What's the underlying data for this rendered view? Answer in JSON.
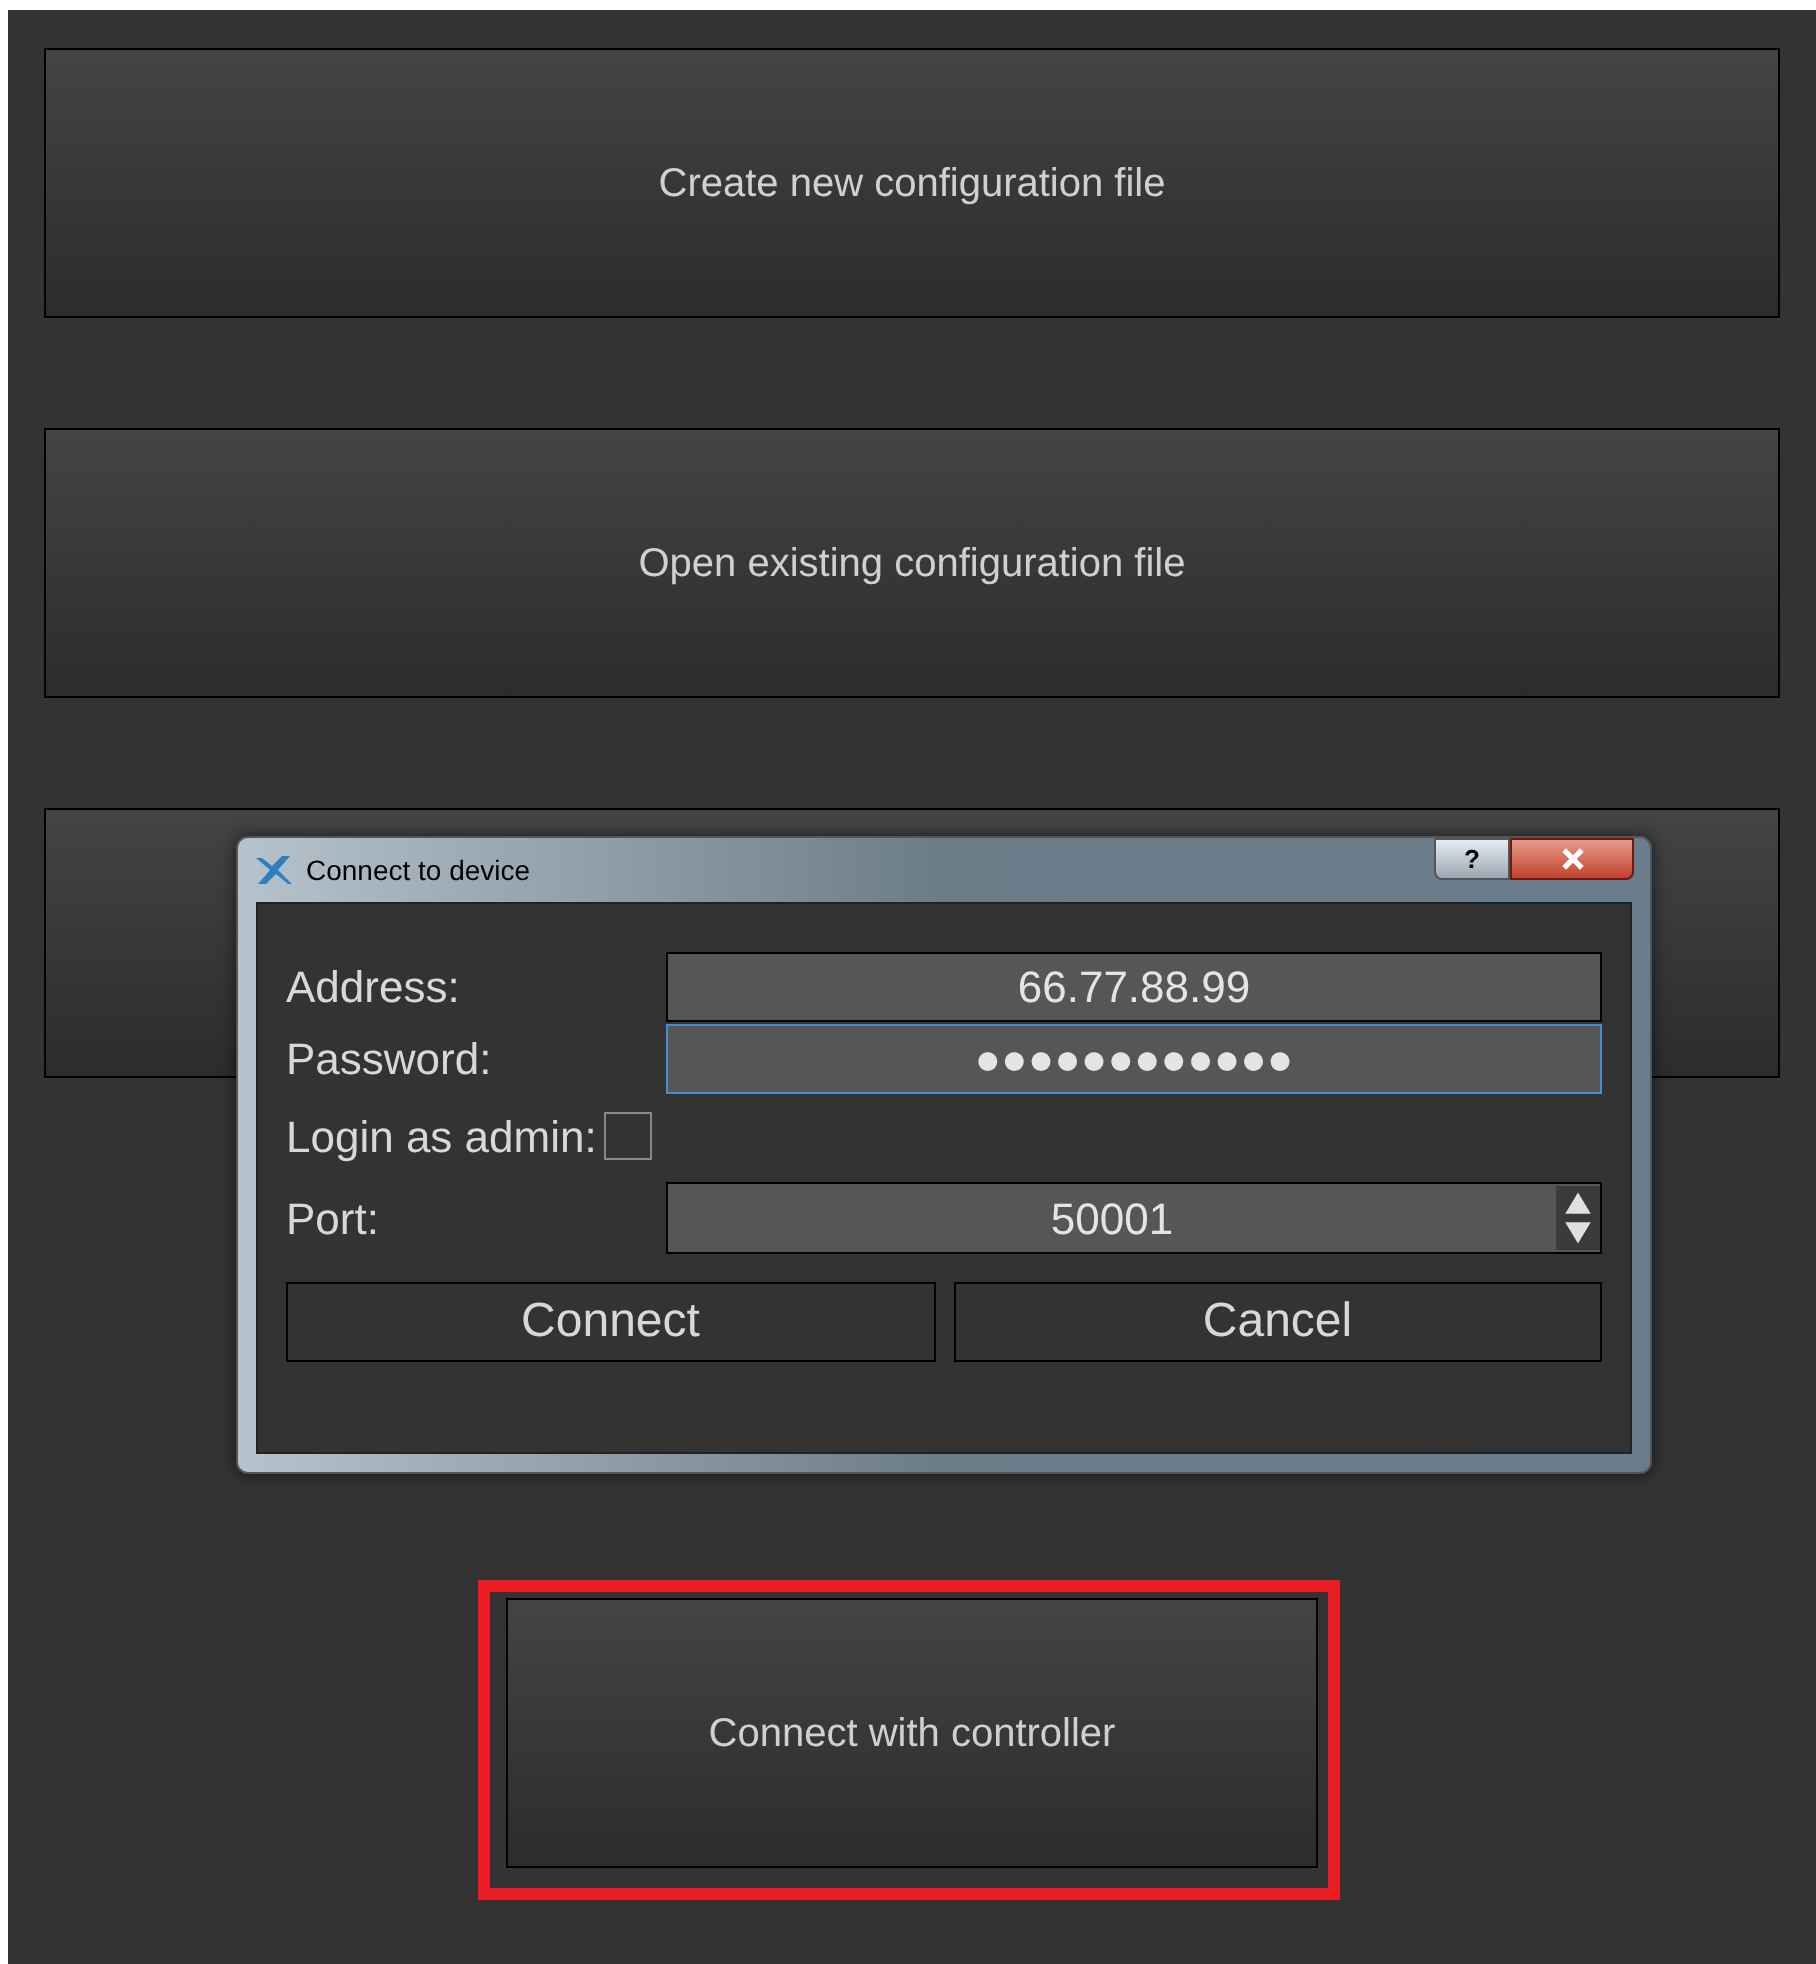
{
  "buttons": [
    {
      "label": "Create new configuration file",
      "highlighted": false
    },
    {
      "label": "Open existing configuration file",
      "highlighted": false
    },
    {
      "highlighted": false
    },
    {
      "label": "Connect with controller",
      "highlighted": true
    }
  ],
  "dialog": {
    "title": "Connect to device",
    "help": "?",
    "fields": [
      {
        "kind": "text",
        "label": "Address:",
        "value": "66.77.88.99",
        "focused": false
      },
      {
        "kind": "text",
        "label": "Password:",
        "value": "●●●●●●●●●●●●",
        "focused": true
      },
      {
        "kind": "checkbox",
        "label": "Login as admin:",
        "checked": false
      },
      {
        "kind": "spin",
        "label": "Port:",
        "value": "50001",
        "focused": false
      }
    ],
    "buttons": [
      "Connect",
      "Cancel"
    ]
  }
}
